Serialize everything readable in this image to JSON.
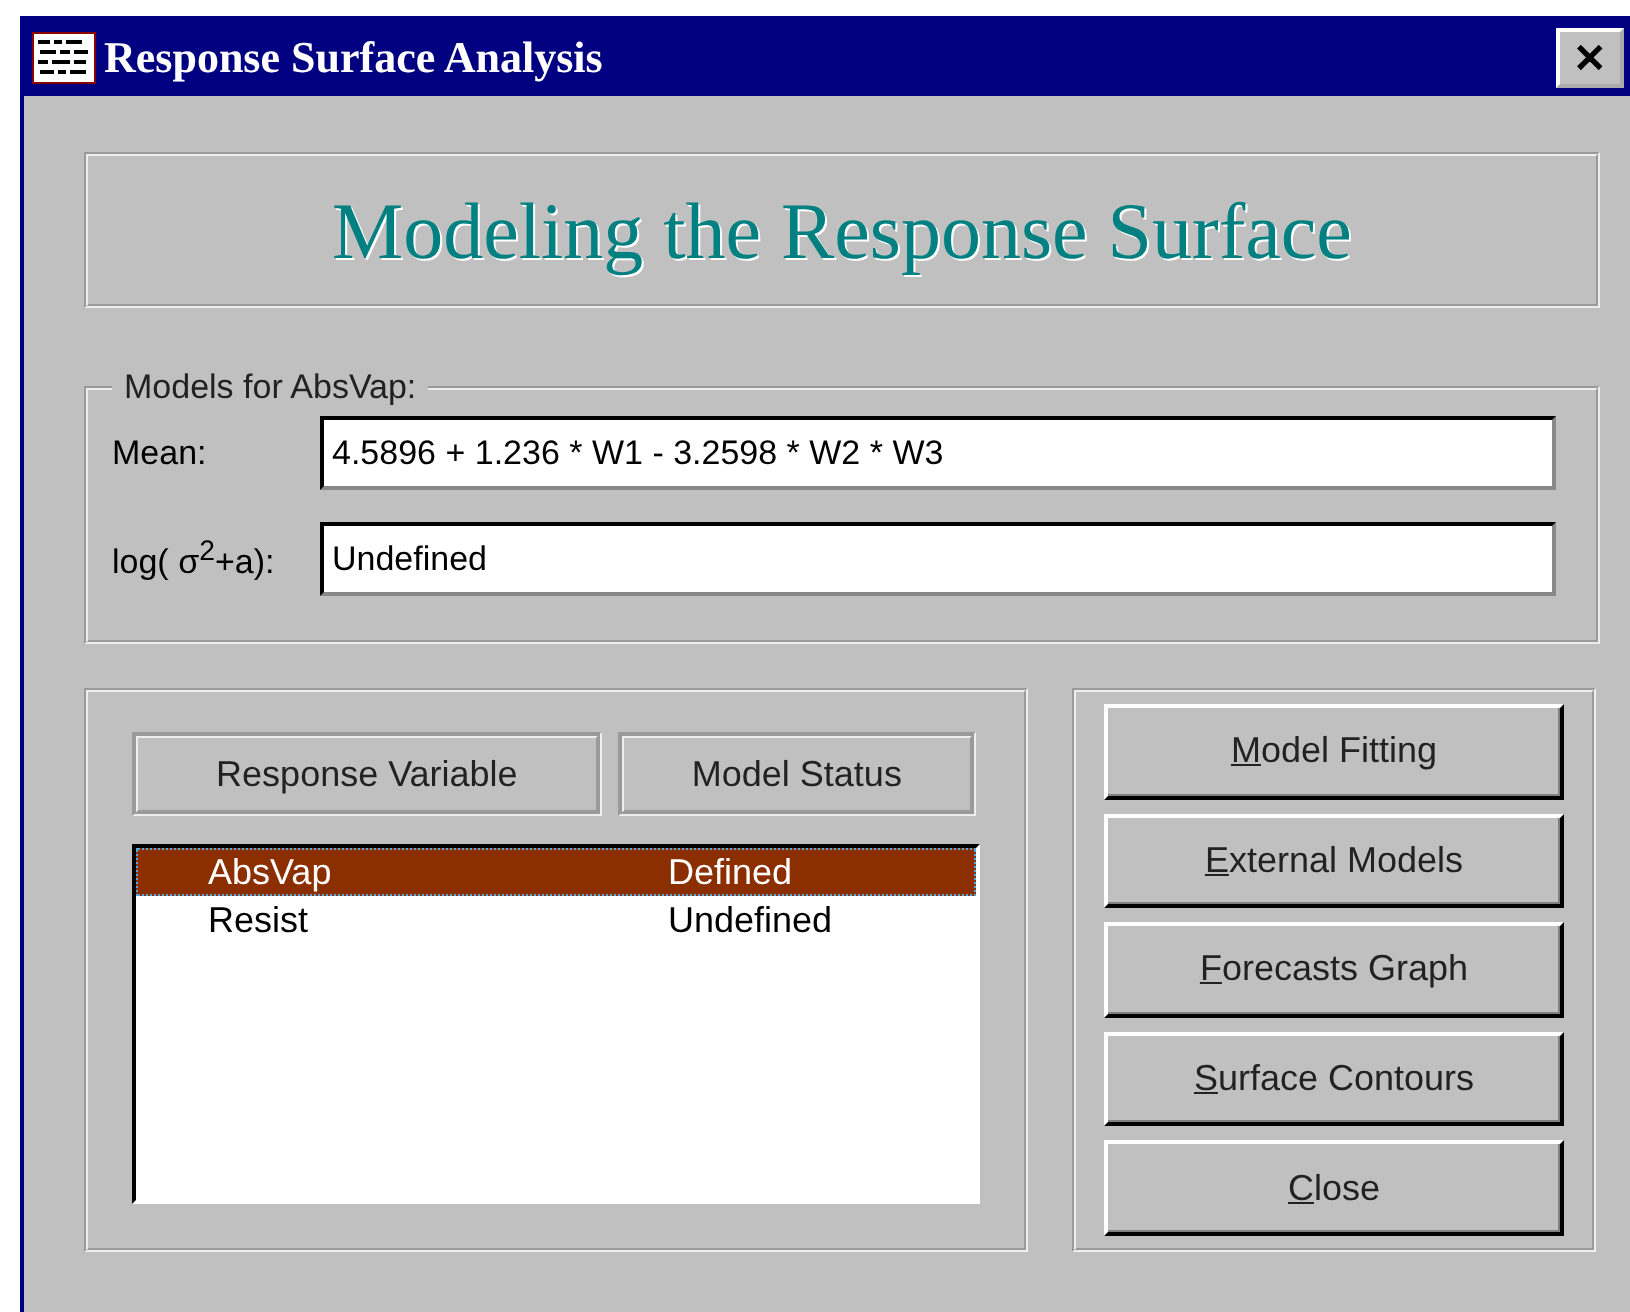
{
  "window": {
    "title": "Response Surface Analysis",
    "close": "✕"
  },
  "banner": "Modeling the Response Surface",
  "models": {
    "legend": "Models for AbsVap:",
    "fields": [
      {
        "label": "Mean:",
        "value": "4.5896 + 1.236 * W1 - 3.2598 * W2 * W3"
      },
      {
        "label": "log( σ$^{2}$+a):",
        "value": "Undefined"
      }
    ]
  },
  "list": {
    "columns": [
      "Response Variable",
      "Model Status"
    ],
    "rows": [
      {
        "variable": "AbsVap",
        "status": "Defined",
        "selected": true
      },
      {
        "variable": "Resist",
        "status": "Undefined",
        "selected": false
      }
    ]
  },
  "buttons": [
    "Model Fitting",
    "External Models",
    "Forecasts Graph",
    "Surface Contours",
    "Close"
  ]
}
